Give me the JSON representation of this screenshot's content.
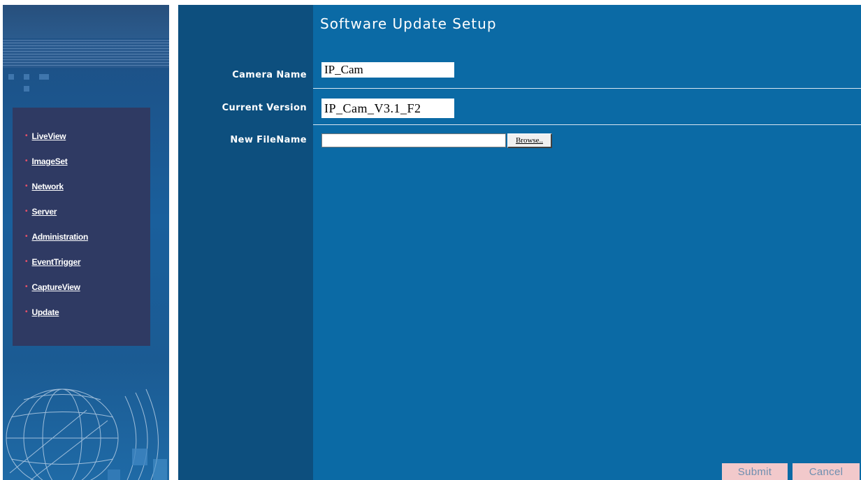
{
  "page": {
    "title": "Software Update Setup"
  },
  "sidebar": {
    "menu": [
      {
        "label": "LiveView"
      },
      {
        "label": "ImageSet"
      },
      {
        "label": "Network"
      },
      {
        "label": "Server"
      },
      {
        "label": "Administration"
      },
      {
        "label": "EventTrigger"
      },
      {
        "label": "CaptureView"
      },
      {
        "label": "Update"
      }
    ]
  },
  "form": {
    "camera_name": {
      "label": "Camera Name",
      "value": "IP_Cam"
    },
    "current_version": {
      "label": "Current Version",
      "value": "IP_Cam_V3.1_F2"
    },
    "new_filename": {
      "label": "New FileName",
      "value": "",
      "browse_label": "Browse.."
    }
  },
  "actions": {
    "submit_label": "Submit",
    "cancel_label": "Cancel"
  },
  "colors": {
    "main_bg": "#0b6aa5",
    "label_column": "#0d4f7e",
    "menu_box": "#2f3a63",
    "menu_bullet": "#e2506a",
    "action_button": "#f2c9cb"
  },
  "icons": {
    "menu_bullet": "bullet-icon",
    "globe": "globe-decoration-icon"
  }
}
